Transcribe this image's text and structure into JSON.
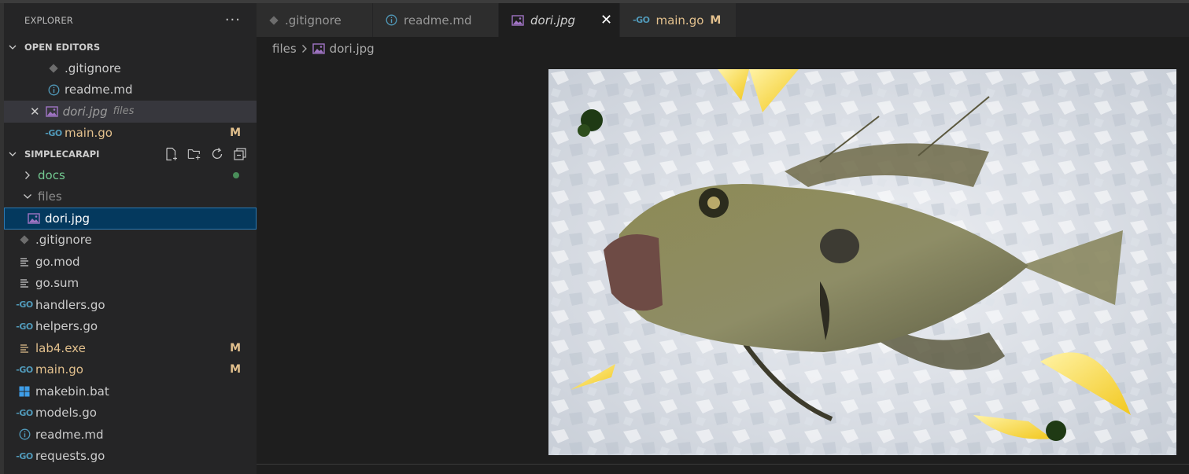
{
  "explorer": {
    "title": "EXPLORER",
    "more_label": "···",
    "open_editors": {
      "header": "OPEN EDITORS",
      "items": [
        {
          "name": ".gitignore",
          "icon": "git-icon"
        },
        {
          "name": "readme.md",
          "icon": "info-icon"
        },
        {
          "name": "dori.jpg",
          "description": "files",
          "icon": "image-icon",
          "active": true,
          "close_glyph": "✕"
        },
        {
          "name": "main.go",
          "icon": "go-icon",
          "status": "M"
        }
      ]
    },
    "project": {
      "header": "SIMPLECARAPI",
      "tree": [
        {
          "name": "docs",
          "type": "folder",
          "expanded": false
        },
        {
          "name": "files",
          "type": "folder",
          "expanded": true
        },
        {
          "name": "dori.jpg",
          "type": "file",
          "icon": "image-icon",
          "selected": true
        },
        {
          "name": ".gitignore",
          "icon": "git-icon"
        },
        {
          "name": "go.mod",
          "icon": "lines-icon"
        },
        {
          "name": "go.sum",
          "icon": "lines-icon"
        },
        {
          "name": "handlers.go",
          "icon": "go-icon"
        },
        {
          "name": "helpers.go",
          "icon": "go-icon"
        },
        {
          "name": "lab4.exe",
          "icon": "windows-icon",
          "status": "M"
        },
        {
          "name": "main.go",
          "icon": "go-icon",
          "status": "M"
        },
        {
          "name": "makebin.bat",
          "icon": "windows-icon"
        },
        {
          "name": "models.go",
          "icon": "go-icon"
        },
        {
          "name": "readme.md",
          "icon": "info-icon"
        },
        {
          "name": "requests.go",
          "icon": "go-icon"
        }
      ]
    }
  },
  "go_glyph": "-GO",
  "tabs": [
    {
      "label": ".gitignore",
      "icon": "git-icon"
    },
    {
      "label": "readme.md",
      "icon": "info-icon"
    },
    {
      "label": "dori.jpg",
      "icon": "image-icon",
      "active": true,
      "close": "✕"
    },
    {
      "label": "main.go",
      "icon": "go-icon",
      "status": "M"
    }
  ],
  "breadcrumb": {
    "folder": "files",
    "file": "dori.jpg"
  },
  "colors": {
    "sidebar_bg": "#252526",
    "editor_bg": "#1e1e1e",
    "selection": "#04395e",
    "modified": "#e2c08d",
    "untracked_green": "#73c991",
    "go_blue": "#519aba",
    "image_purple": "#a074c4"
  }
}
